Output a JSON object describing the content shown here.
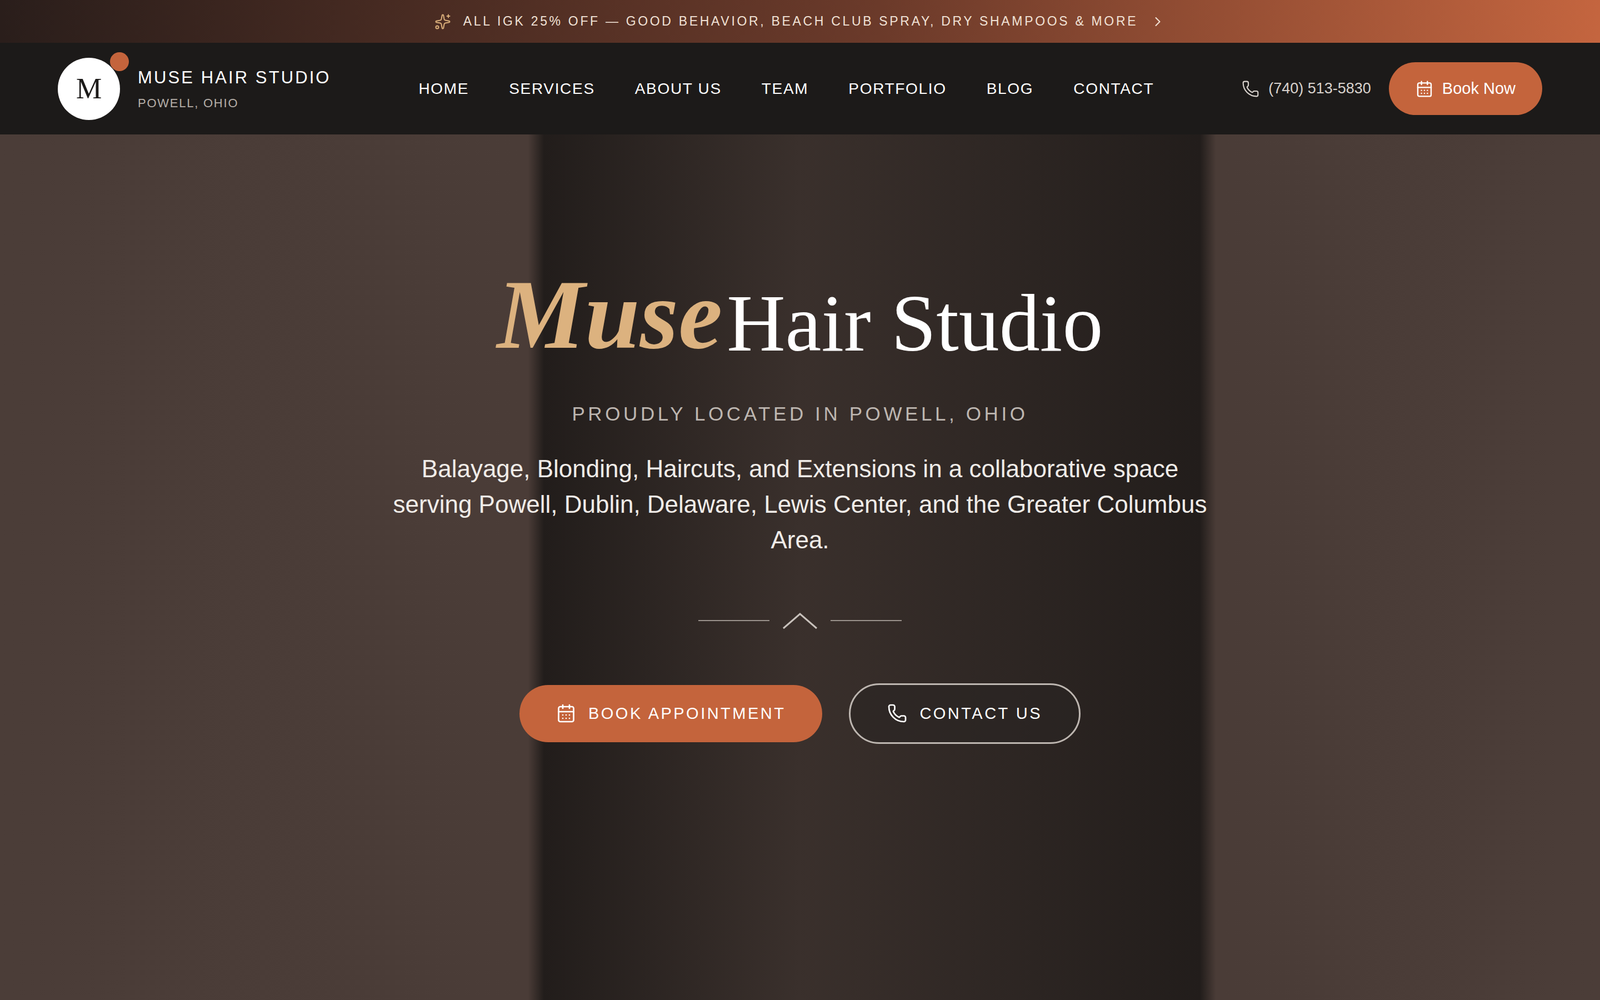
{
  "announcement": {
    "text": "ALL IGK 25% OFF — GOOD BEHAVIOR, BEACH CLUB SPRAY, DRY SHAMPOOS & MORE"
  },
  "brand": {
    "monogram": "M",
    "name": "MUSE HAIR STUDIO",
    "location": "POWELL, OHIO"
  },
  "nav": [
    {
      "label": "HOME",
      "selected": false
    },
    {
      "label": "SERVICES",
      "selected": false
    },
    {
      "label": "ABOUT US",
      "selected": false
    },
    {
      "label": "TEAM",
      "selected": false
    },
    {
      "label": "PORTFOLIO",
      "selected": false
    },
    {
      "label": "BLOG",
      "selected": false
    },
    {
      "label": "CONTACT",
      "selected": false
    }
  ],
  "phone": "(740) 513-5830",
  "book_button": "Book Now",
  "hero": {
    "script": "Muse",
    "title": "Hair Studio",
    "subtitle": "PROUDLY LOCATED IN POWELL, OHIO",
    "description": "Balayage, Blonding, Haircuts, and Extensions in a collaborative space serving Powell, Dublin, Delaware, Lewis Center, and the Greater Columbus Area.",
    "buttons": [
      {
        "label": "BOOK APPOINTMENT",
        "kind": "primary"
      },
      {
        "label": "CONTACT US",
        "kind": "outline"
      }
    ]
  }
}
